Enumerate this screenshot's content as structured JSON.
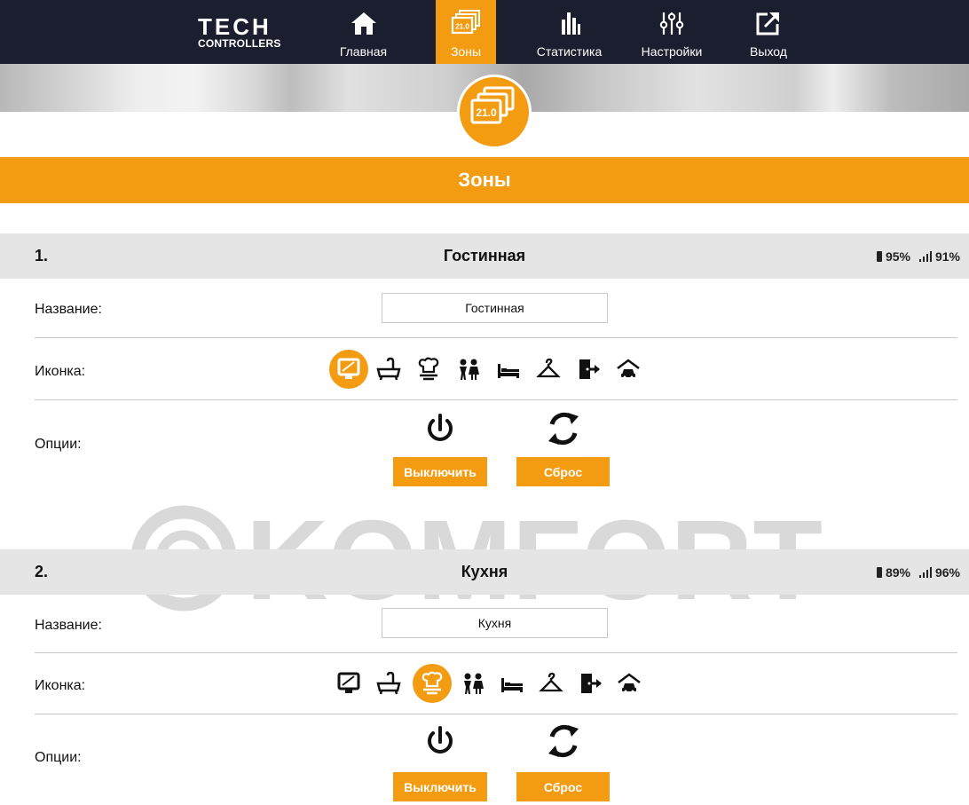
{
  "nav": {
    "logo_top": "TECH",
    "logo_bottom": "CONTROLLERS",
    "items": [
      {
        "label": "Главная",
        "icon": "home-icon"
      },
      {
        "label": "Зоны",
        "icon": "zones-icon",
        "badge": "21.0",
        "active": true
      },
      {
        "label": "Статистика",
        "icon": "statistics-icon"
      },
      {
        "label": "Настройки",
        "icon": "settings-icon"
      },
      {
        "label": "Выход",
        "icon": "logout-icon"
      }
    ]
  },
  "banner": {
    "badge_value": "21.0"
  },
  "page_title": "Зоны",
  "zones": [
    {
      "number": "1.",
      "title": "Гостинная",
      "battery": "95%",
      "signal": "91%",
      "name_label": "Название:",
      "name_value": "Гостинная",
      "icon_label": "Иконка:",
      "icons": [
        "living-room-icon",
        "bathroom-icon",
        "kitchen-icon",
        "children-room-icon",
        "bedroom-icon",
        "wardrobe-icon",
        "entrance-icon",
        "garage-icon"
      ],
      "selected_icon": "living-room-icon",
      "options_label": "Опции:",
      "turn_off_label": "Выключить",
      "reset_label": "Сброс"
    },
    {
      "number": "2.",
      "title": "Кухня",
      "battery": "89%",
      "signal": "96%",
      "name_label": "Название:",
      "name_value": "Кухня",
      "icon_label": "Иконка:",
      "icons": [
        "living-room-icon",
        "bathroom-icon",
        "kitchen-icon",
        "children-room-icon",
        "bedroom-icon",
        "wardrobe-icon",
        "entrance-icon",
        "garage-icon"
      ],
      "selected_icon": "kitchen-icon",
      "options_label": "Опции:",
      "turn_off_label": "Выключить",
      "reset_label": "Сброс"
    }
  ],
  "watermark": {
    "text": "KOMFORT"
  },
  "colors": {
    "accent": "#f39c12",
    "nav_bg": "#1b1e2e",
    "zone_header_bg": "#e5e5e5"
  }
}
